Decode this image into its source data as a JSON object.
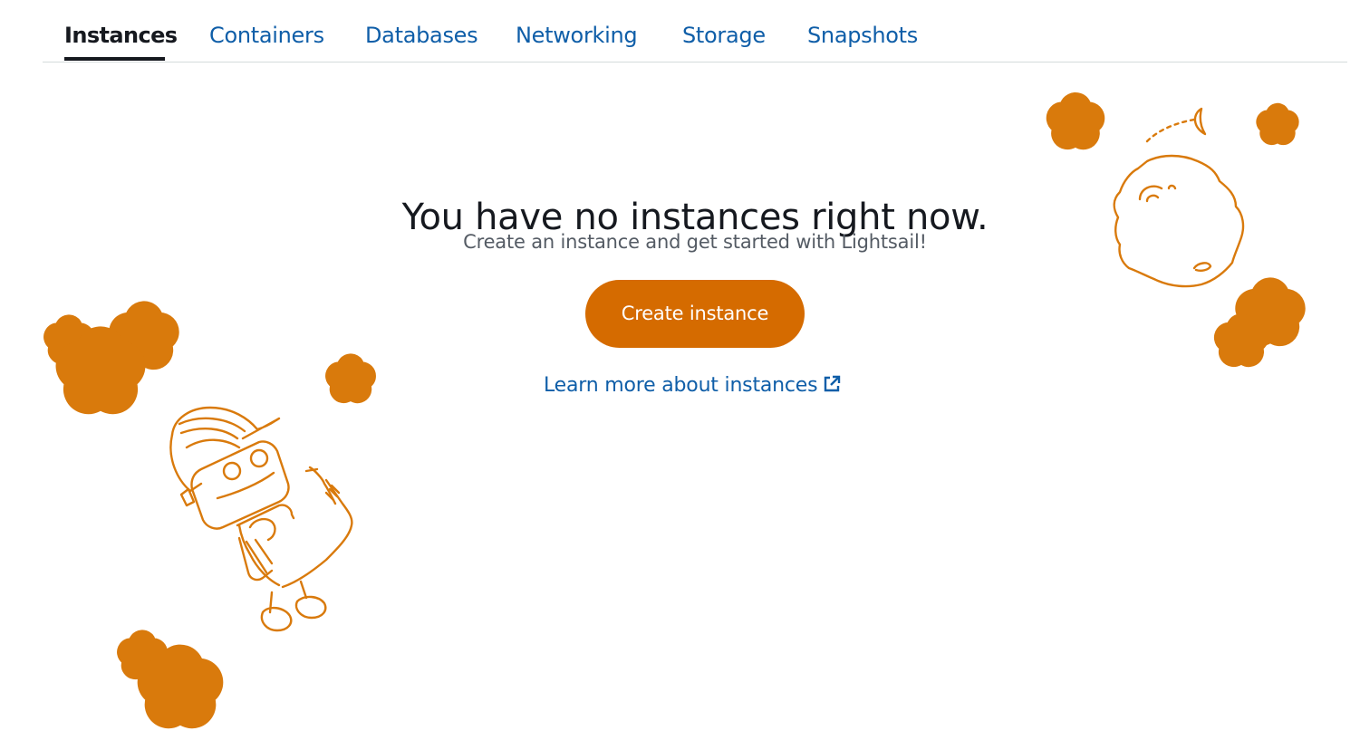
{
  "tabs": [
    {
      "label": "Instances",
      "active": true
    },
    {
      "label": "Containers",
      "active": false
    },
    {
      "label": "Databases",
      "active": false
    },
    {
      "label": "Networking",
      "active": false
    },
    {
      "label": "Storage",
      "active": false
    },
    {
      "label": "Snapshots",
      "active": false
    }
  ],
  "empty_state": {
    "title": "You have no instances right now.",
    "subtitle": "Create an instance and get started with Lightsail!",
    "create_button_label": "Create instance",
    "learn_more_label": "Learn more about instances",
    "learn_more_icon": "external-link-icon"
  },
  "colors": {
    "link": "#0f5ea8",
    "primary_button": "#d56b00",
    "illustration_stroke": "#d97a0c",
    "text": "#16191f",
    "secondary_text": "#545b64"
  },
  "icons": {
    "illustration": "robot-astronaut-illustration",
    "moon": "moon-illustration",
    "star": "star-icon"
  }
}
